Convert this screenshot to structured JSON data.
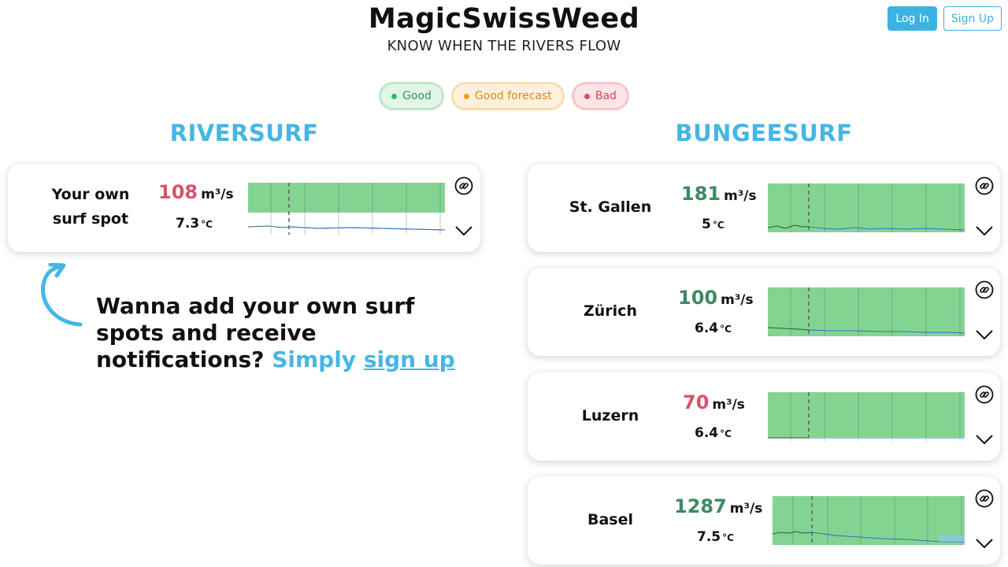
{
  "header": {
    "title": "MagicSwissWeed",
    "subtitle": "KNOW WHEN THE RIVERS FLOW"
  },
  "auth": {
    "login_label": "Log In",
    "signup_label": "Sign Up"
  },
  "legend": {
    "good": "Good",
    "good_forecast": "Good forecast",
    "bad": "Bad"
  },
  "columns": {
    "riversurf": "RIVERSURF",
    "bungeesurf": "BUNGEESURF"
  },
  "units": {
    "flow": "m³/s",
    "temp": "°C"
  },
  "riversurf_spots": [
    {
      "name_line1": "Your own",
      "name_line2": "surf spot",
      "flow": "108",
      "temp": "7.3",
      "status": "bad"
    }
  ],
  "bungeesurf_spots": [
    {
      "name": "St. Gallen",
      "flow": "181",
      "temp": "5",
      "status": "good"
    },
    {
      "name": "Zürich",
      "flow": "100",
      "temp": "6.4",
      "status": "good"
    },
    {
      "name": "Luzern",
      "flow": "70",
      "temp": "6.4",
      "status": "bad"
    },
    {
      "name": "Basel",
      "flow": "1287",
      "temp": "7.5",
      "status": "good"
    }
  ],
  "promo": {
    "text": "Wanna add your own surf spots and receive notifications?",
    "simply": "Simply",
    "link": "sign up"
  },
  "icons": {
    "link": "link-icon",
    "expand": "chevron-down-icon",
    "arrow": "curved-arrow-icon"
  },
  "colors": {
    "accent": "#46b6e4",
    "good": "#2fbf57",
    "good_forecast": "#f39c12",
    "bad": "#e24b56",
    "chart_fill": "#84d491",
    "flow_line": "#2a6fd1"
  }
}
